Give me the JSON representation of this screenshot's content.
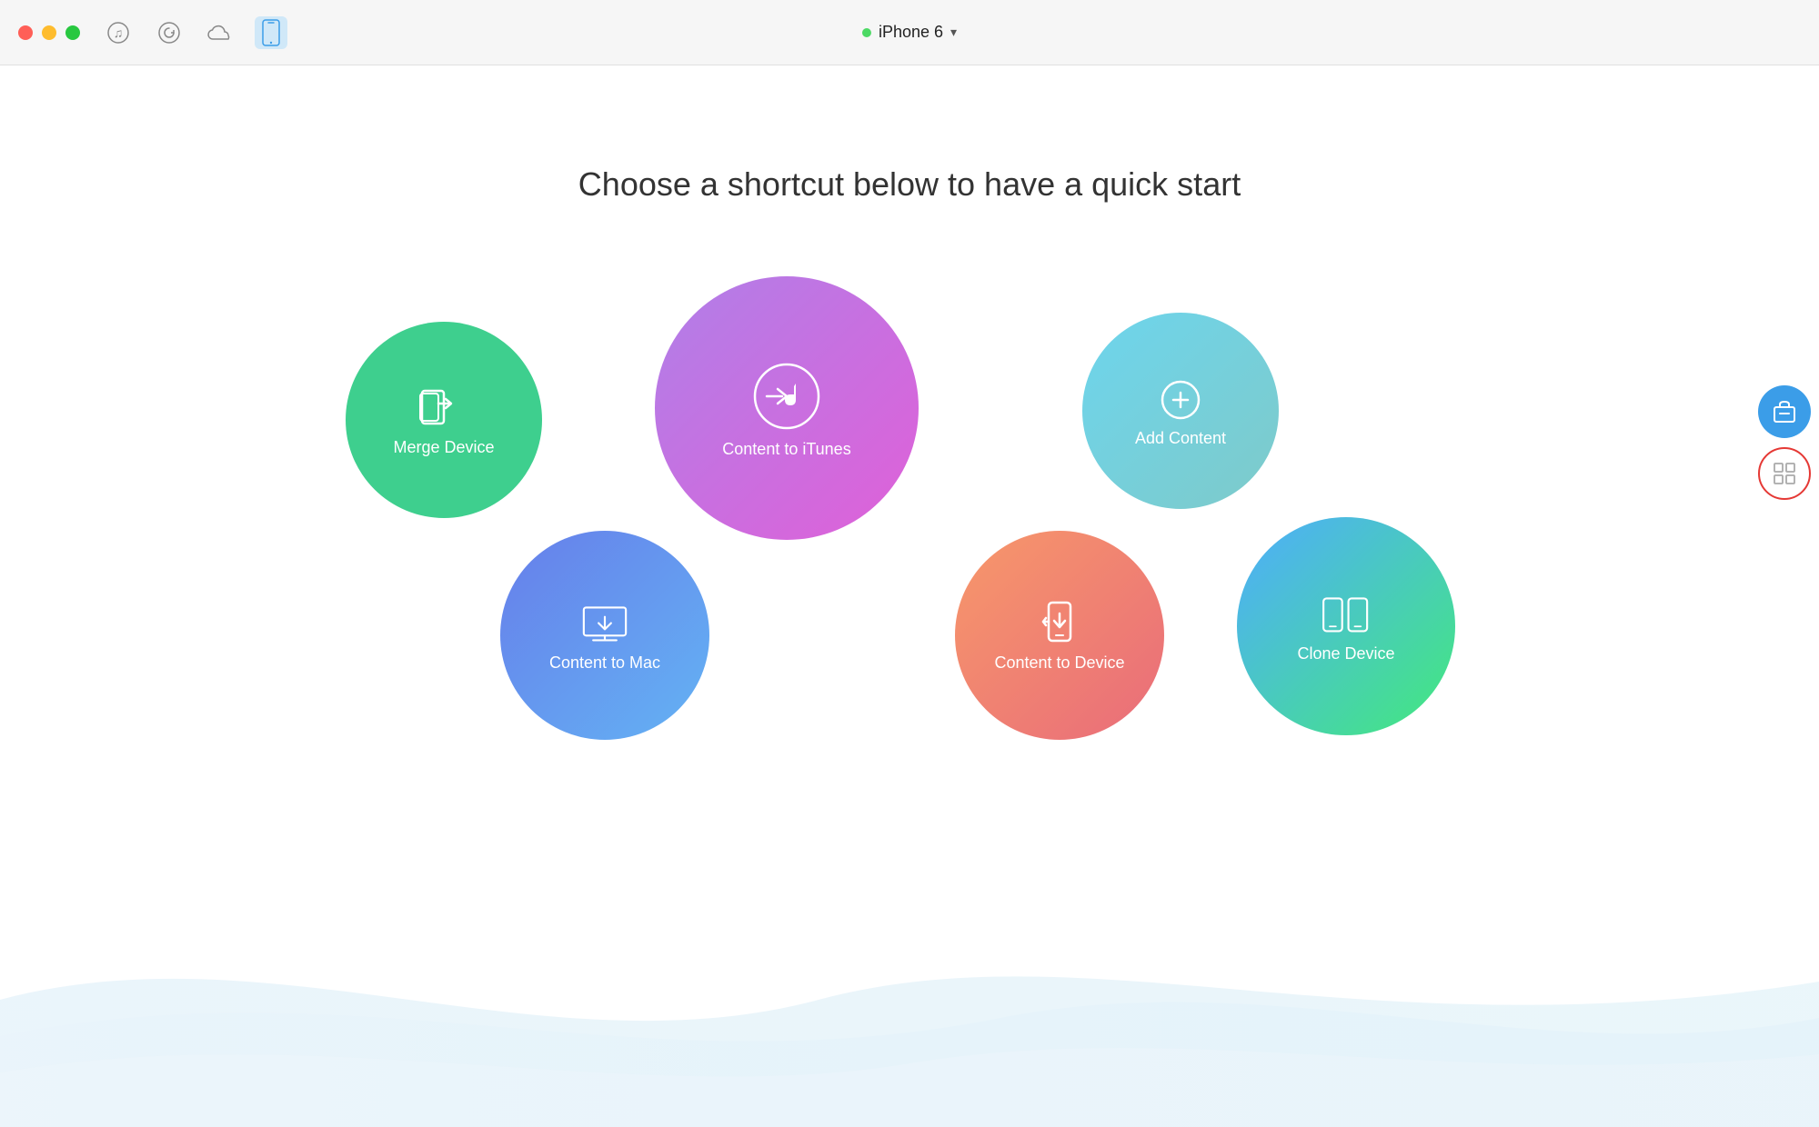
{
  "titlebar": {
    "traffic_lights": [
      "close",
      "minimize",
      "maximize"
    ],
    "icons": [
      {
        "name": "music-icon",
        "symbol": "♫"
      },
      {
        "name": "history-icon",
        "symbol": "⟳"
      },
      {
        "name": "cloud-icon",
        "symbol": "☁"
      },
      {
        "name": "phone-icon",
        "symbol": "📱",
        "active": true
      }
    ],
    "device": {
      "dot_color": "#4cd964",
      "name": "iPhone 6",
      "chevron": "▾"
    }
  },
  "main": {
    "title": "Choose a shortcut below to have a quick start",
    "shortcuts": [
      {
        "id": "merge-device",
        "label": "Merge Device",
        "icon": "merge"
      },
      {
        "id": "content-itunes",
        "label": "Content to iTunes",
        "icon": "music"
      },
      {
        "id": "add-content",
        "label": "Add Content",
        "icon": "add"
      },
      {
        "id": "content-mac",
        "label": "Content to Mac",
        "icon": "mac"
      },
      {
        "id": "content-device",
        "label": "Content to Device",
        "icon": "device"
      },
      {
        "id": "clone-device",
        "label": "Clone Device",
        "icon": "clone"
      }
    ]
  },
  "sidebar": {
    "buttons": [
      {
        "id": "tools-btn",
        "icon": "briefcase",
        "style": "blue"
      },
      {
        "id": "grid-btn",
        "icon": "grid",
        "style": "grid"
      }
    ]
  }
}
